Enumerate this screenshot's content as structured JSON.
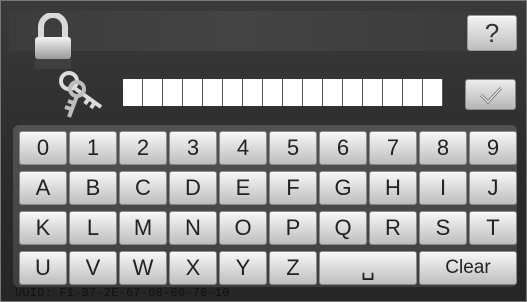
{
  "help_button": {
    "label": "?"
  },
  "pin_input": {
    "cell_count": 16,
    "value": ""
  },
  "keyboard": {
    "rows": [
      [
        "0",
        "1",
        "2",
        "3",
        "4",
        "5",
        "6",
        "7",
        "8",
        "9"
      ],
      [
        "A",
        "B",
        "C",
        "D",
        "E",
        "F",
        "G",
        "H",
        "I",
        "J"
      ],
      [
        "K",
        "L",
        "M",
        "N",
        "O",
        "P",
        "Q",
        "R",
        "S",
        "T"
      ],
      [
        "U",
        "V",
        "W",
        "X",
        "Y",
        "Z"
      ]
    ],
    "space_label": "␣",
    "clear_label": "Clear"
  },
  "footer": {
    "uuid_text": "UUID: F1-B7-2E-67-08-60-76-10"
  },
  "colors": {
    "background": "#2a2a2a",
    "key_face": "#e6e6e6",
    "key_text": "#222222",
    "pin_cell": "#ffffff"
  },
  "icons": {
    "lock": "padlock-icon",
    "keys": "keys-icon",
    "confirm": "checkmark-icon"
  }
}
